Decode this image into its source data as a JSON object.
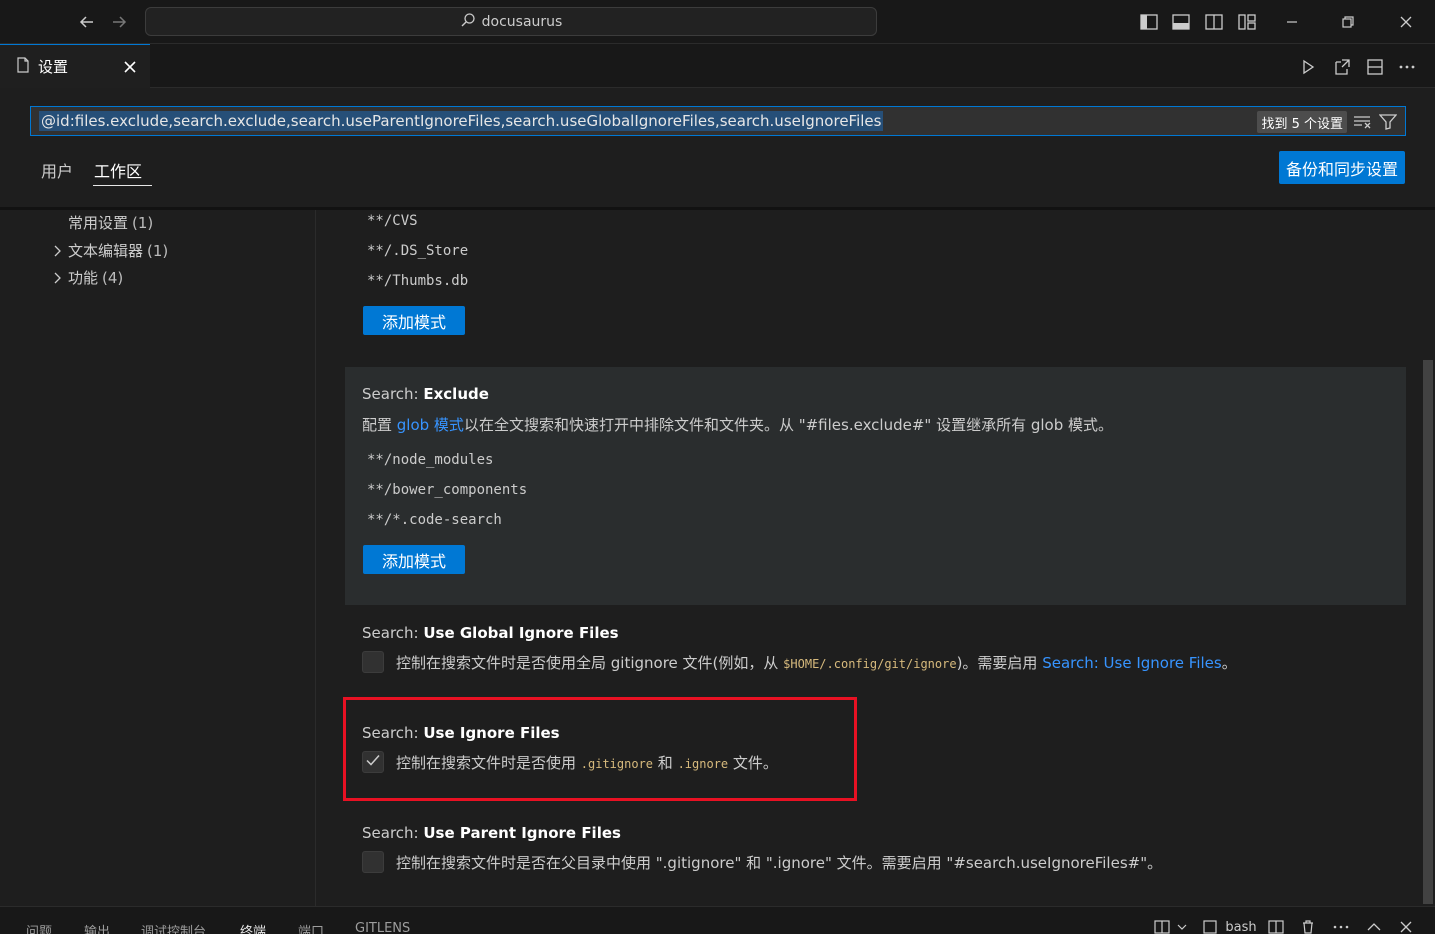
{
  "titlebar": {
    "back_icon": "arrow-left-icon",
    "forward_icon": "arrow-right-icon",
    "command_center_text": "docusaurus"
  },
  "editor": {
    "tab_label": "设置"
  },
  "settings": {
    "search_query": "@id:files.exclude,search.exclude,search.useParentIgnoreFiles,search.useGlobalIgnoreFiles,search.useIgnoreFiles",
    "found_badge": "找到 5 个设置",
    "scope_tabs": [
      "用户",
      "工作区"
    ],
    "active_scope": "工作区",
    "sync_button": "备份和同步设置",
    "toc": [
      {
        "label": "常用设置",
        "count": "(1)"
      },
      {
        "label": "文本编辑器",
        "count": "(1)"
      },
      {
        "label": "功能",
        "count": "(4)"
      }
    ],
    "files_exclude_patterns": [
      "**/CVS",
      "**/.DS_Store",
      "**/Thumbs.db"
    ],
    "add_pattern_button": "添加模式",
    "search_exclude": {
      "category": "Search: ",
      "name": "Exclude",
      "desc_prefix": "配置 ",
      "desc_link": "glob 模式",
      "desc_suffix": "以在全文搜索和快速打开中排除文件和文件夹。从 \"#files.exclude#\" 设置继承所有 glob 模式。",
      "patterns": [
        "**/node_modules",
        "**/bower_components",
        "**/*.code-search"
      ],
      "add_button": "添加模式"
    },
    "use_global_ignore": {
      "category": "Search: ",
      "name": "Use Global Ignore Files",
      "desc_prefix": "控制在搜索文件时是否使用全局 gitignore 文件(例如，从 ",
      "desc_code": "$HOME/.config/git/ignore",
      "desc_mid": ")。需要启用 ",
      "desc_link": "Search: Use Ignore Files",
      "desc_suffix": "。",
      "checked": false
    },
    "use_ignore_files": {
      "category": "Search: ",
      "name": "Use Ignore Files",
      "desc_prefix": "控制在搜索文件时是否使用 ",
      "code1": ".gitignore",
      "desc_mid": " 和 ",
      "code2": ".ignore",
      "desc_suffix": " 文件。",
      "checked": true
    },
    "use_parent_ignore": {
      "category": "Search: ",
      "name": "Use Parent Ignore Files",
      "desc": "控制在搜索文件时是否在父目录中使用 \".gitignore\" 和 \".ignore\" 文件。需要启用 \"#search.useIgnoreFiles#\"。",
      "checked": false
    }
  },
  "panel": {
    "tabs": [
      "问题",
      "输出",
      "调试控制台",
      "终端",
      "端口",
      "GITLENS"
    ],
    "active_tab": "终端",
    "terminal_name": "bash"
  },
  "colors": {
    "accent": "#0078d4",
    "link": "#3794ff",
    "highlight_box": "#e81123"
  }
}
